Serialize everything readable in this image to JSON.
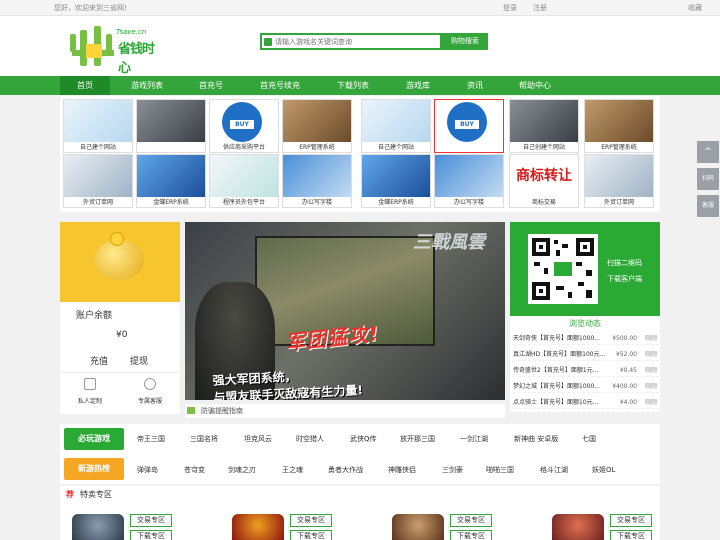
{
  "topbar": {
    "welcome": "您好，欢迎来到三省网!",
    "login": "登录",
    "register": "注册",
    "favorite": "收藏"
  },
  "logo": {
    "domain": "Tsave.cn",
    "text": "省钱时心"
  },
  "search": {
    "placeholder": "请输入游戏名关键词查询",
    "button": "购物搜索"
  },
  "nav": [
    "首页",
    "游戏列表",
    "首充号",
    "首充号续充",
    "下载列表",
    "游戏库",
    "资讯",
    "帮助中心"
  ],
  "tiles": [
    "自己建个网站",
    "",
    "供应商采购平台",
    "ERP管理系统",
    "自己建个网站",
    "",
    "自己创建个网站",
    "ERP管理系统",
    "外贸订单网",
    "金蝶ERP系统",
    "程序员外包平台",
    "办公写字楼",
    "金蝶ERP系统",
    "办公写字楼",
    "商标交易",
    "外贸订单网"
  ],
  "trademark_text": "商标转让",
  "buy_text": "BUY",
  "user": {
    "balance_label": "账户余额",
    "balance_value": "¥0",
    "recharge": "充值",
    "withdraw": "提现",
    "custom": "私人定制",
    "service": "专属客服"
  },
  "banner": {
    "logo": "三戰風雲",
    "slogan": "军团猛攻!",
    "text1": "强大军团系统，",
    "text2": "与盟友联手灭敌寇有生力量!"
  },
  "notice": "防骗提醒指南",
  "qr": {
    "scan": "扫描二维码",
    "download": "下载客户端"
  },
  "dynamics": {
    "title": "浏览动态",
    "rows": [
      {
        "name": "天剑奇侠【首充号】面额1000...",
        "price": "¥500.00",
        "time": "刚刚"
      },
      {
        "name": "真江湖HD【首充号】面额100元...",
        "price": "¥52.00",
        "time": "刚刚"
      },
      {
        "name": "传奇盛世2【首充号】面额1元...",
        "price": "¥0.45",
        "time": "刚刚"
      },
      {
        "name": "梦幻之城【首充号】面额1000...",
        "price": "¥400.00",
        "time": "刚刚"
      },
      {
        "name": "点点骑士【首充号】面额10元...",
        "price": "¥4.00",
        "time": "刚刚"
      }
    ]
  },
  "categories": [
    {
      "tag": "必玩游戏",
      "color": "#2aa934",
      "items": [
        "帝王三国",
        "三国名将",
        "坦克风云",
        "时空猎人",
        "武侠Q传",
        "放开那三国",
        "一剑江湖",
        "新神曲 安卓版",
        "七国"
      ]
    },
    {
      "tag": "新游热榜",
      "color": "#f5a623",
      "items": [
        "弹弹岛",
        "苍穹变",
        "剑魂之刃",
        "王之魂",
        "勇者大作战",
        "神雕侠侣",
        "三剑豪",
        "啪啪三国",
        "格斗江湖",
        "妖姬OL"
      ]
    }
  ],
  "special": {
    "mark": "荐",
    "title": "特卖专区",
    "trade": "交易专区",
    "download": "下载专区"
  },
  "float": {
    "top": "^",
    "qr": "扫码",
    "service": "客服"
  }
}
